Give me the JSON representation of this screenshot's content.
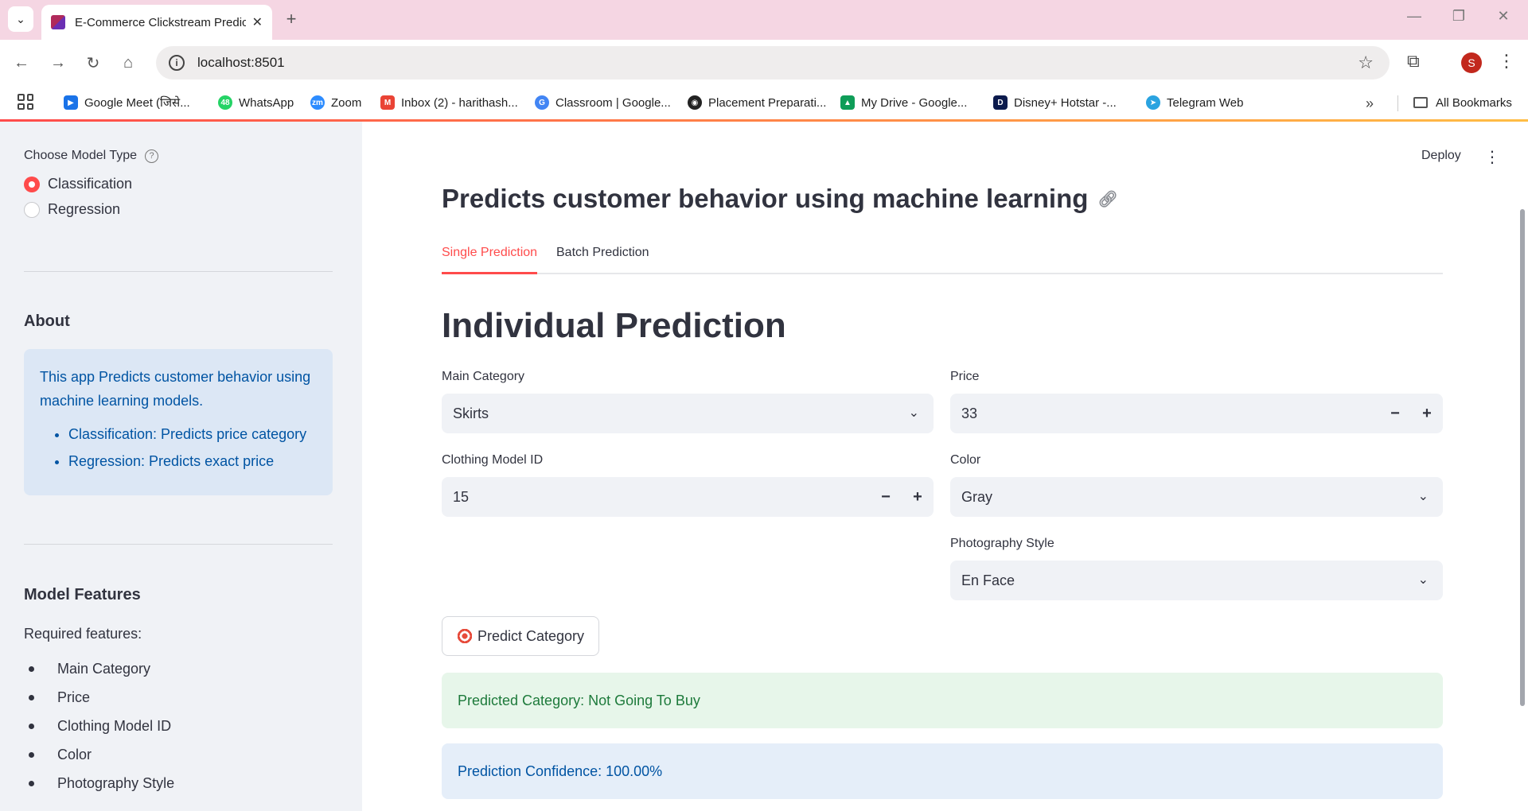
{
  "browser": {
    "tab_title": "E-Commerce Clickstream Predic",
    "url": "localhost:8501",
    "profile_initial": "S",
    "bookmarks": [
      {
        "label": "Google Meet (जिसे...",
        "icon": "google-meet-icon",
        "color": "#1a73e8"
      },
      {
        "label": "WhatsApp",
        "icon": "whatsapp-icon",
        "color": "#25d366"
      },
      {
        "label": "Zoom",
        "icon": "zoom-icon",
        "color": "#2d8cff"
      },
      {
        "label": "Inbox (2) - harithash...",
        "icon": "gmail-icon",
        "color": "#ea4335"
      },
      {
        "label": "Classroom | Google...",
        "icon": "google-icon",
        "color": "#4285f4"
      },
      {
        "label": "Placement Preparati...",
        "icon": "globe-icon",
        "color": "#222222"
      },
      {
        "label": "My Drive - Google...",
        "icon": "google-drive-icon",
        "color": "#0f9d58"
      },
      {
        "label": "Disney+ Hotstar -...",
        "icon": "hotstar-icon",
        "color": "#0c1b4d"
      },
      {
        "label": "Telegram Web",
        "icon": "telegram-icon",
        "color": "#2aa3e0"
      }
    ],
    "all_bookmarks": "All Bookmarks"
  },
  "sidebar": {
    "model_type_label": "Choose Model Type",
    "options": [
      "Classification",
      "Regression"
    ],
    "selected": "Classification",
    "about_heading": "About",
    "about_text": "This app Predicts customer behavior using machine learning models.",
    "about_bullets": [
      "Classification: Predicts price category",
      "Regression: Predicts exact price"
    ],
    "features_heading": "Model Features",
    "required_label": "Required features:",
    "features": [
      "Main Category",
      "Price",
      "Clothing Model ID",
      "Color",
      "Photography Style"
    ]
  },
  "main": {
    "deploy_label": "Deploy",
    "title": "Predicts customer behavior using machine learning",
    "tabs": [
      "Single Prediction",
      "Batch Prediction"
    ],
    "active_tab": "Single Prediction",
    "section_heading": "Individual Prediction",
    "fields": {
      "main_category": {
        "label": "Main Category",
        "value": "Skirts"
      },
      "price": {
        "label": "Price",
        "value": "33"
      },
      "clothing_model_id": {
        "label": "Clothing Model ID",
        "value": "15"
      },
      "color": {
        "label": "Color",
        "value": "Gray"
      },
      "photography_style": {
        "label": "Photography Style",
        "value": "En Face"
      }
    },
    "predict_button": "Predict Category",
    "result_success": "Predicted Category: Not Going To Buy",
    "result_info": "Prediction Confidence: 100.00%"
  },
  "colors": {
    "accent": "#ff4b4b",
    "success_text": "#1d7a3b",
    "info_text": "#0054a3"
  }
}
